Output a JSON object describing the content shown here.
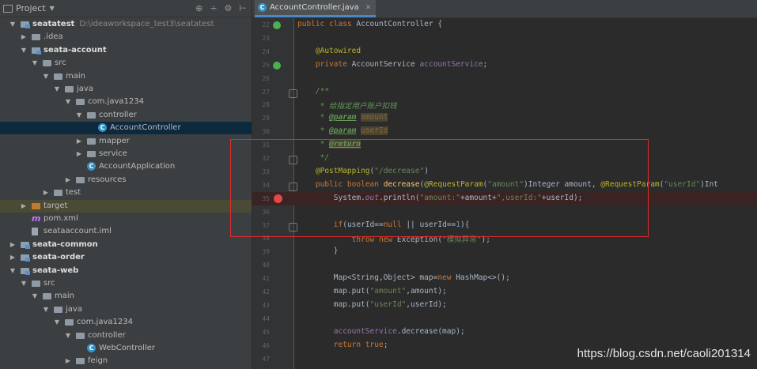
{
  "project_panel": {
    "title": "Project",
    "tree": [
      {
        "label": "seatatest",
        "path": "D:\\ideaworkspace_test3\\seatatest",
        "icon": "module-icon",
        "arrow": "open",
        "bold": true
      },
      {
        "label": ".idea",
        "icon": "folder-icon",
        "arrow": "closed"
      },
      {
        "label": "seata-account",
        "icon": "module-icon",
        "arrow": "open",
        "bold": true
      },
      {
        "label": "src",
        "icon": "source-folder-icon",
        "arrow": "open"
      },
      {
        "label": "main",
        "icon": "folder-icon",
        "arrow": "open"
      },
      {
        "label": "java",
        "icon": "source-folder-icon",
        "arrow": "open"
      },
      {
        "label": "com.java1234",
        "icon": "package-icon",
        "arrow": "open"
      },
      {
        "label": "controller",
        "icon": "package-icon",
        "arrow": "open"
      },
      {
        "label": "AccountController",
        "icon": "class-icon",
        "selected": true
      },
      {
        "label": "mapper",
        "icon": "package-icon",
        "arrow": "closed"
      },
      {
        "label": "service",
        "icon": "package-icon",
        "arrow": "closed"
      },
      {
        "label": "AccountApplication",
        "icon": "spring-class-icon"
      },
      {
        "label": "resources",
        "icon": "resources-folder-icon",
        "arrow": "closed"
      },
      {
        "label": "test",
        "icon": "folder-icon",
        "arrow": "closed"
      },
      {
        "label": "target",
        "icon": "target-folder-icon",
        "arrow": "closed",
        "highlight": true
      },
      {
        "label": "pom.xml",
        "icon": "maven-icon"
      },
      {
        "label": "seataaccount.iml",
        "icon": "iml-file-icon"
      },
      {
        "label": "seata-common",
        "icon": "module-icon",
        "arrow": "closed",
        "bold": true
      },
      {
        "label": "seata-order",
        "icon": "module-icon",
        "arrow": "closed",
        "bold": true
      },
      {
        "label": "seata-web",
        "icon": "module-icon",
        "arrow": "open",
        "bold": true
      },
      {
        "label": "src",
        "icon": "source-folder-icon",
        "arrow": "open"
      },
      {
        "label": "main",
        "icon": "folder-icon",
        "arrow": "open"
      },
      {
        "label": "java",
        "icon": "source-folder-icon",
        "arrow": "open"
      },
      {
        "label": "com.java1234",
        "icon": "package-icon",
        "arrow": "open"
      },
      {
        "label": "controller",
        "icon": "package-icon",
        "arrow": "open"
      },
      {
        "label": "WebController",
        "icon": "class-icon"
      },
      {
        "label": "feign",
        "icon": "package-icon",
        "arrow": "closed"
      }
    ]
  },
  "editor": {
    "tab_label": "AccountController.java",
    "lines": [
      {
        "n": "22",
        "html": "<span class='kw'>public class </span><span class='cls'>AccountController </span>{"
      },
      {
        "n": "23",
        "html": ""
      },
      {
        "n": "24",
        "html": "    <span class='ann'>@Autowired</span>"
      },
      {
        "n": "25",
        "html": "    <span class='kw'>private </span>AccountService <span class='fld'>accountService</span>;"
      },
      {
        "n": "26",
        "html": ""
      },
      {
        "n": "27",
        "html": "    <span class='cmt'>/**</span>"
      },
      {
        "n": "28",
        "html": "<span class='cmt'>     * 给指定用户账户扣钱</span>"
      },
      {
        "n": "29",
        "html": "<span class='cmt'>     * </span><span class='tag'>@param</span><span class='cmt'> </span><span class='tagv'>amount</span>"
      },
      {
        "n": "30",
        "html": "<span class='cmt'>     * </span><span class='tag'>@param</span><span class='cmt'> </span><span class='tagv'>userId</span>"
      },
      {
        "n": "31",
        "html": "<span class='cmt'>     * </span><span class='tag' style='background:#494531'>@return</span>"
      },
      {
        "n": "32",
        "html": "<span class='cmt'>     */</span>"
      },
      {
        "n": "33",
        "html": "    <span class='ann'>@PostMapping</span>(<span class='str'>\"/decrease\"</span>)"
      },
      {
        "n": "34",
        "html": "    <span class='kw'>public boolean </span><span class='fn'>decrease</span>(<span class='ann'>@RequestParam</span>(<span class='str'>\"amount\"</span>)Integer amount, <span class='ann'>@RequestParam</span>(<span class='str'>\"userId\"</span>)Int"
      },
      {
        "n": "35",
        "html": "        System.<span class='static'>out</span>.println(<span class='str'>\"amount:\"</span>+amount+<span class='str'>\",userId:\"</span>+userId);"
      },
      {
        "n": "36",
        "html": ""
      },
      {
        "n": "37",
        "html": "        <span class='kw'>if</span>(userId==<span class='kw'>null </span>|| userId==<span class='num'>1</span>){"
      },
      {
        "n": "38",
        "html": "            <span class='kw'>throw new </span>Exception(<span class='str'>\"模拟异常\"</span>);"
      },
      {
        "n": "39",
        "html": "        }"
      },
      {
        "n": "40",
        "html": ""
      },
      {
        "n": "41",
        "html": "        Map&lt;String,Object&gt; map=<span class='kw'>new </span>HashMap&lt;&gt;();"
      },
      {
        "n": "42",
        "html": "        map.put(<span class='str'>\"amount\"</span>,amount);"
      },
      {
        "n": "43",
        "html": "        map.put(<span class='str'>\"userId\"</span>,userId);"
      },
      {
        "n": "44",
        "html": ""
      },
      {
        "n": "45",
        "html": "        <span class='fld'>accountService</span>.decrease(map);"
      },
      {
        "n": "46",
        "html": "        <span class='kw'>return true</span>;"
      },
      {
        "n": "47",
        "html": ""
      }
    ],
    "breakpoint_line": "35"
  },
  "watermark": "https://blog.csdn.net/caoli201314"
}
